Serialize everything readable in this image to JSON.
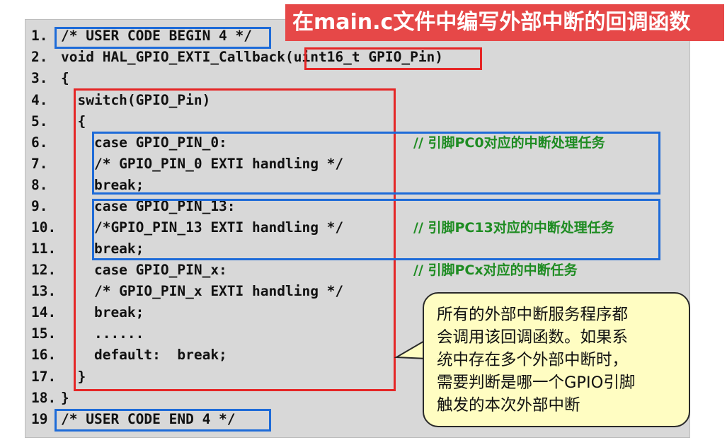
{
  "title": "在main.c文件中编写外部中断的回调函数",
  "code_lines": [
    {
      "no": "1.",
      "text": "/* USER CODE BEGIN 4 */"
    },
    {
      "no": "2.",
      "text": "void HAL_GPIO_EXTI_Callback(uint16_t GPIO_Pin)"
    },
    {
      "no": "3.",
      "text": "{"
    },
    {
      "no": "4.",
      "text": "  switch(GPIO_Pin)"
    },
    {
      "no": "5.",
      "text": "  {"
    },
    {
      "no": "6.",
      "text": "    case GPIO_PIN_0:"
    },
    {
      "no": "7.",
      "text": "    /* GPIO_PIN_0 EXTI handling */"
    },
    {
      "no": "8.",
      "text": "    break;"
    },
    {
      "no": "9.",
      "text": "    case GPIO_PIN_13:"
    },
    {
      "no": "10.",
      "text": "    /*GPIO_PIN_13 EXTI handling */"
    },
    {
      "no": "11.",
      "text": "    break;"
    },
    {
      "no": "12.",
      "text": "    case GPIO_PIN_x:"
    },
    {
      "no": "13.",
      "text": "    /* GPIO_PIN_x EXTI handling */"
    },
    {
      "no": "14.",
      "text": "    break;"
    },
    {
      "no": "15.",
      "text": "    ......"
    },
    {
      "no": "16.",
      "text": "    default:  break;"
    },
    {
      "no": "17.",
      "text": "  }"
    },
    {
      "no": "18.",
      "text": "}"
    },
    {
      "no": "19",
      "text": "/* USER CODE END 4 */"
    }
  ],
  "comments": [
    "// 引脚PC0对应的中断处理任务",
    "// 引脚PC13对应的中断处理任务",
    "// 引脚PCx对应的中断任务"
  ],
  "callout": {
    "lines": [
      "所有的外部中断服务程序都",
      "会调用该回调函数。如果系",
      "统中存在多个外部中断时，",
      "需要判断是哪一个GPIO引脚",
      "触发的本次外部中断"
    ]
  },
  "colors": {
    "title_bg": "#e64848",
    "panel_bg": "#d8d8d8",
    "red_box": "#e52626",
    "blue_box": "#1e6bd8",
    "comment": "#1e8c22",
    "callout_bg": "#fffdc2"
  }
}
